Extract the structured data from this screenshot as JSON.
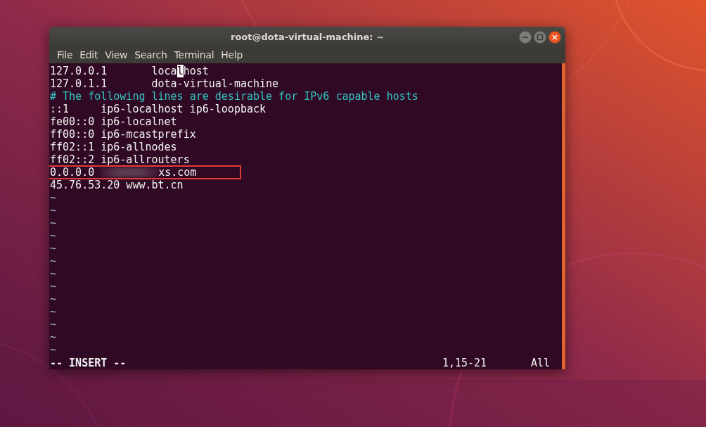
{
  "window": {
    "title": "root@dota-virtual-machine: ~"
  },
  "menu": [
    {
      "label": "File"
    },
    {
      "label": "Edit"
    },
    {
      "label": "View"
    },
    {
      "label": "Search"
    },
    {
      "label": "Terminal"
    },
    {
      "label": "Help"
    }
  ],
  "editor": {
    "lines": [
      {
        "kind": "cursor",
        "before": "127.0.0.1       loca",
        "cursor": "l",
        "after": "host"
      },
      {
        "kind": "text",
        "text": "127.0.1.1       dota-virtual-machine"
      },
      {
        "kind": "comment",
        "text": "# The following lines are desirable for IPv6 capable hosts"
      },
      {
        "kind": "text",
        "text": "::1     ip6-localhost ip6-loopback"
      },
      {
        "kind": "text",
        "text": "fe00::0 ip6-localnet"
      },
      {
        "kind": "text",
        "text": "ff00::0 ip6-mcastprefix"
      },
      {
        "kind": "text",
        "text": "ff02::1 ip6-allnodes"
      },
      {
        "kind": "text",
        "text": "ff02::2 ip6-allrouters"
      },
      {
        "kind": "redacted",
        "before": "0.0.0.0",
        "after": "xs.com"
      },
      {
        "kind": "text",
        "text": "45.76.53.20 www.bt.cn"
      },
      {
        "kind": "tilde",
        "text": "~"
      },
      {
        "kind": "tilde",
        "text": "~"
      },
      {
        "kind": "tilde",
        "text": "~"
      },
      {
        "kind": "tilde",
        "text": "~"
      },
      {
        "kind": "tilde",
        "text": "~"
      },
      {
        "kind": "tilde",
        "text": "~"
      },
      {
        "kind": "tilde",
        "text": "~"
      },
      {
        "kind": "tilde",
        "text": "~"
      },
      {
        "kind": "tilde",
        "text": "~"
      },
      {
        "kind": "tilde",
        "text": "~"
      },
      {
        "kind": "tilde",
        "text": "~"
      },
      {
        "kind": "tilde",
        "text": "~"
      },
      {
        "kind": "tilde",
        "text": "~"
      }
    ],
    "status": {
      "mode": "-- INSERT --",
      "position": "1,15-21",
      "scroll": "All"
    }
  },
  "annotation": {
    "kind": "highlight"
  }
}
